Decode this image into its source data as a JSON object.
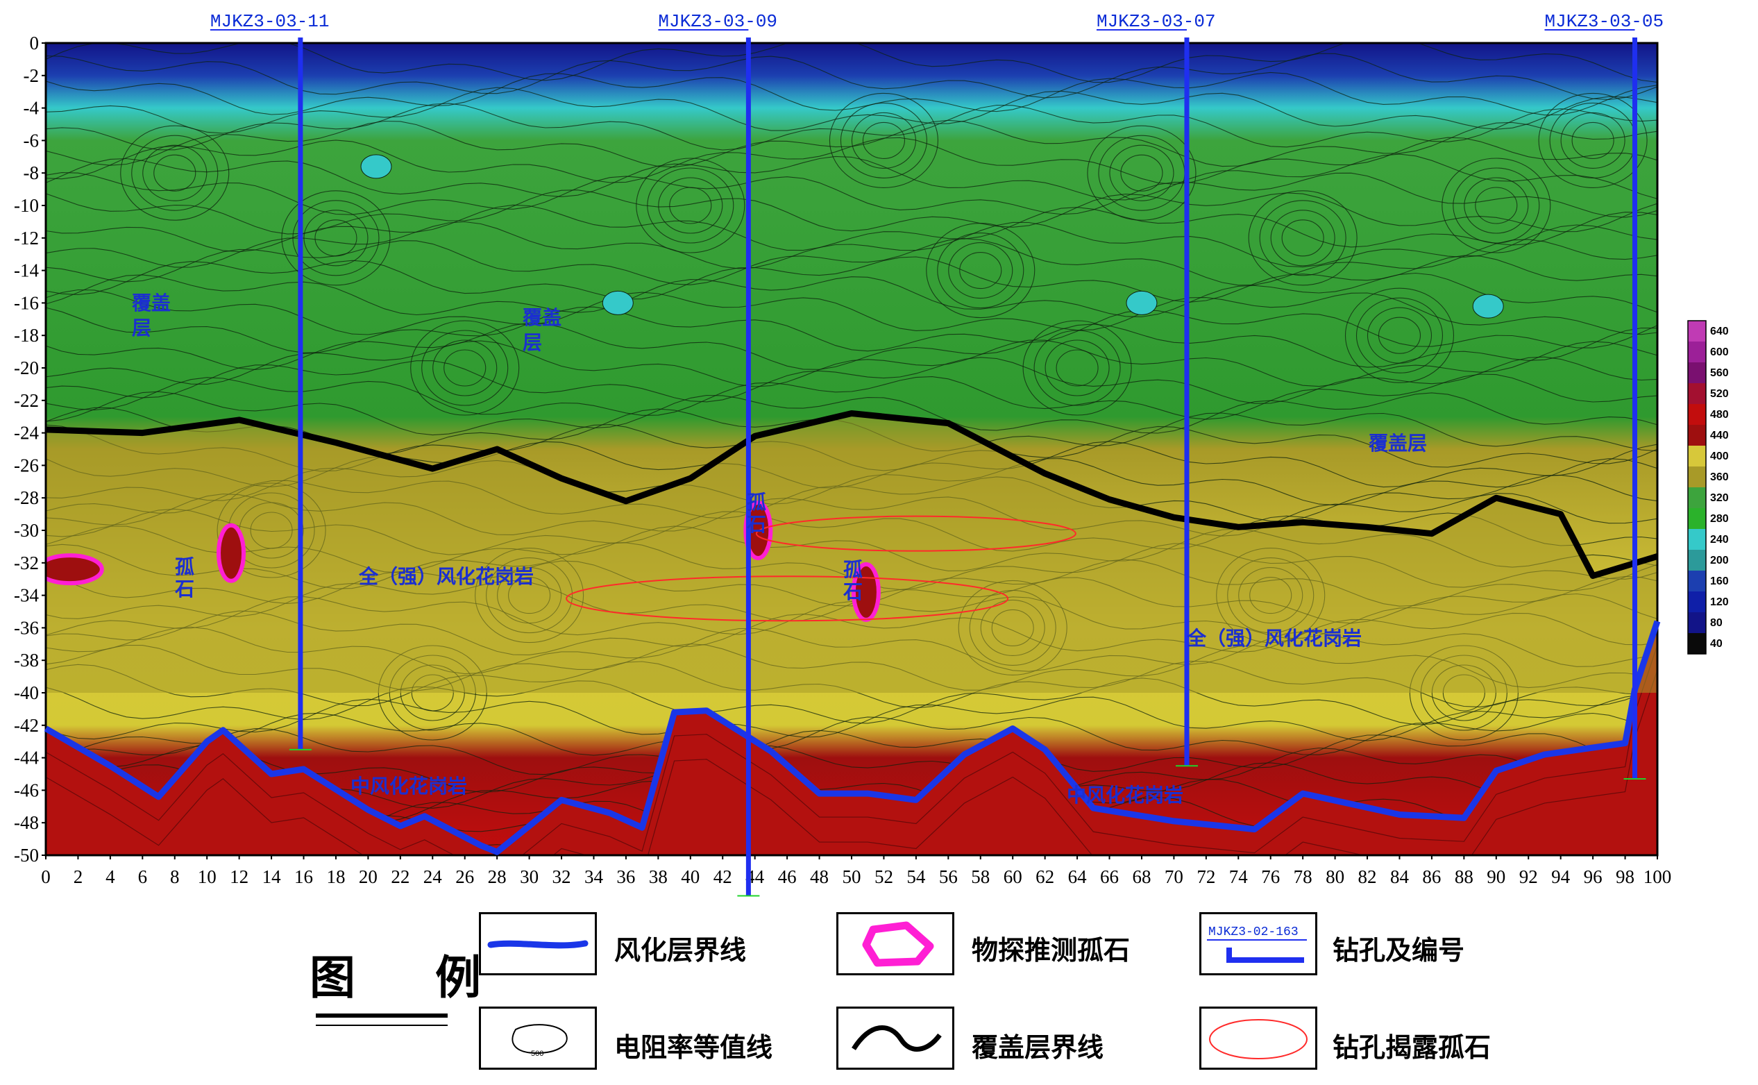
{
  "chart_data": {
    "type": "heatmap",
    "x_ticks": [
      "0",
      "2",
      "4",
      "6",
      "8",
      "10",
      "12",
      "14",
      "16",
      "18",
      "20",
      "22",
      "24",
      "26",
      "28",
      "30",
      "32",
      "34",
      "36",
      "38",
      "40",
      "42",
      "44",
      "46",
      "48",
      "50",
      "52",
      "54",
      "56",
      "58",
      "60",
      "62",
      "64",
      "66",
      "68",
      "70",
      "72",
      "74",
      "76",
      "78",
      "80",
      "82",
      "84",
      "86",
      "88",
      "90",
      "92",
      "94",
      "96",
      "98",
      "100"
    ],
    "y_ticks": [
      "0",
      "-2",
      "-4",
      "-6",
      "-8",
      "-10",
      "-12",
      "-14",
      "-16",
      "-18",
      "-20",
      "-22",
      "-24",
      "-26",
      "-28",
      "-30",
      "-32",
      "-34",
      "-36",
      "-38",
      "-40",
      "-42",
      "-44",
      "-46",
      "-48",
      "-50"
    ],
    "xlim": [
      0,
      100
    ],
    "ylim": [
      -50,
      0
    ],
    "colorbar": {
      "labels": [
        "640",
        "600",
        "560",
        "520",
        "480",
        "440",
        "400",
        "360",
        "320",
        "280",
        "240",
        "200",
        "160",
        "120",
        "80",
        "40"
      ],
      "colors": [
        "#c03bb4",
        "#9c2098",
        "#7a1070",
        "#a31030",
        "#c20d0d",
        "#9e0f0f",
        "#d7c83a",
        "#a89a28",
        "#3da43d",
        "#2bb22b",
        "#35c9c9",
        "#2c9a9a",
        "#1c3fb0",
        "#0f1fa8",
        "#121488",
        "#0a0a0a"
      ]
    },
    "boreholes": [
      {
        "name": "MJKZ3-03-11",
        "x": 15.8,
        "bottom": -43.5
      },
      {
        "name": "MJKZ3-03-09",
        "x": 43.6,
        "bottom": -52.5
      },
      {
        "name": "MJKZ3-03-07",
        "x": 70.8,
        "bottom": -44.5
      },
      {
        "name": "MJKZ3-03-05",
        "x": 98.6,
        "bottom": -45.3
      }
    ],
    "cover_boundary": [
      [
        0,
        -23.8
      ],
      [
        6,
        -24
      ],
      [
        12,
        -23.2
      ],
      [
        18,
        -24.6
      ],
      [
        24,
        -26.2
      ],
      [
        28,
        -25
      ],
      [
        32,
        -26.8
      ],
      [
        36,
        -28.2
      ],
      [
        40,
        -26.8
      ],
      [
        44,
        -24.2
      ],
      [
        50,
        -22.8
      ],
      [
        56,
        -23.4
      ],
      [
        62,
        -26.5
      ],
      [
        66,
        -28.1
      ],
      [
        70,
        -29.2
      ],
      [
        74,
        -29.8
      ],
      [
        78,
        -29.5
      ],
      [
        82,
        -29.8
      ],
      [
        86,
        -30.2
      ],
      [
        90,
        -28
      ],
      [
        94,
        -29
      ],
      [
        96,
        -32.8
      ],
      [
        100,
        -31.6
      ]
    ],
    "weathering_boundary": [
      [
        0,
        -42.2
      ],
      [
        4,
        -44.5
      ],
      [
        7,
        -46.4
      ],
      [
        10,
        -43
      ],
      [
        11,
        -42.3
      ],
      [
        14,
        -45
      ],
      [
        16,
        -44.7
      ],
      [
        20,
        -47.2
      ],
      [
        22,
        -48.2
      ],
      [
        23.5,
        -47.6
      ],
      [
        27,
        -49.4
      ],
      [
        28,
        -49.8
      ],
      [
        32,
        -46.6
      ],
      [
        35,
        -47.4
      ],
      [
        37,
        -48.3
      ],
      [
        39,
        -41.2
      ],
      [
        41,
        -41.1
      ],
      [
        45,
        -43.6
      ],
      [
        48,
        -46.2
      ],
      [
        51,
        -46.2
      ],
      [
        54,
        -46.6
      ],
      [
        57,
        -43.8
      ],
      [
        60,
        -42.2
      ],
      [
        62,
        -43.5
      ],
      [
        65,
        -47.1
      ],
      [
        70,
        -47.9
      ],
      [
        73,
        -48.2
      ],
      [
        75,
        -48.4
      ],
      [
        78,
        -46.2
      ],
      [
        84,
        -47.5
      ],
      [
        88,
        -47.7
      ],
      [
        90,
        -44.8
      ],
      [
        93,
        -43.8
      ],
      [
        98,
        -43.1
      ],
      [
        98.6,
        -39.8
      ],
      [
        100,
        -35.6
      ]
    ],
    "boulders_inferred": [
      {
        "x": 1.5,
        "y": -32.4
      },
      {
        "x": 11.5,
        "y": -31.4
      },
      {
        "x": 44.2,
        "y": -30
      },
      {
        "x": 50.9,
        "y": -33.8
      }
    ],
    "boulders_drilled": [
      {
        "x": 54,
        "y": -30.2
      },
      {
        "x": 46,
        "y": -34.2
      }
    ]
  },
  "labels": {
    "cover1": "覆盖层",
    "cover2": "覆盖层",
    "cover3": "覆盖层",
    "boulder1": "孤石",
    "boulder2": "孤石",
    "boulder3": "孤石",
    "weathered1": "全（强）风化花岗岩",
    "weathered2": "全（强）风化花岗岩",
    "medium1": "中风化花岗岩",
    "medium2": "中风化花岗岩"
  },
  "legend": {
    "title": "图 例",
    "items": {
      "weathering_line": "风化层界线",
      "geophys_boulder": "物探推测孤石",
      "borehole": "钻孔及编号",
      "borehole_sample_label": "MJKZ3-02-163",
      "resistivity_line": "电阻率等值线",
      "resistivity_sample_label": "500",
      "cover_line": "覆盖层界线",
      "drilled_boulder": "钻孔揭露孤石"
    }
  },
  "colors": {
    "boundary_blue": "#1a36e8",
    "borehole_blue": "#1f2ff0",
    "cover_line": "#000000",
    "boulder_pink": "#ff1fd4",
    "drilled_red": "#ff2a2a"
  }
}
